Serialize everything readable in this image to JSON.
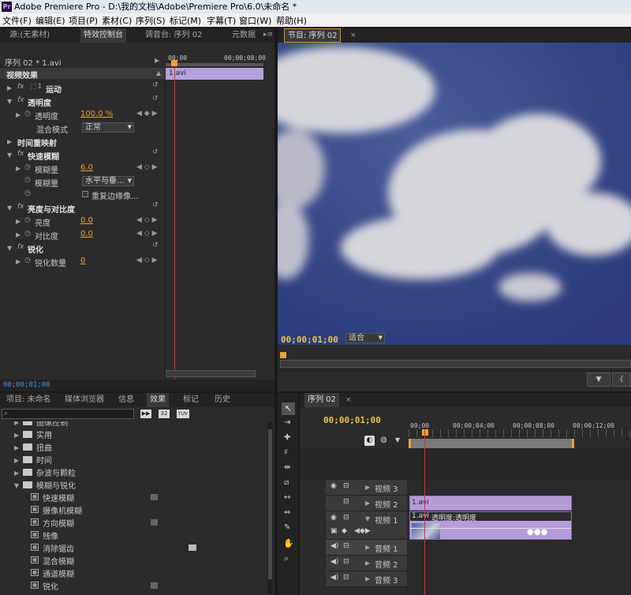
{
  "titlebar": {
    "icon": "Pr",
    "title": "Adobe Premiere Pro - D:\\我的文档\\Adobe\\Premiere Pro\\6.0\\未命名 *"
  },
  "menubar": [
    "文件(F)",
    "编辑(E)",
    "项目(P)",
    "素材(C)",
    "序列(S)",
    "标记(M)",
    "字幕(T)",
    "窗口(W)",
    "帮助(H)"
  ],
  "effect_controls": {
    "tabs": [
      "源:(无素材)",
      "特效控制台",
      "调音台: 序列 02",
      "元数据"
    ],
    "sequence": "序列 02 * 1.avi",
    "ruler_start": "00;00",
    "ruler_end": "00;00;08;00",
    "clip_label": "1.avi",
    "section": "视频效果",
    "motion": "运动",
    "opacity": "透明度",
    "opacity_param": "透明度",
    "opacity_value": "100.0 %",
    "blend_label": "混合模式",
    "blend_value": "正常",
    "time_remap": "时间重映射",
    "fast_blur": "快速模糊",
    "blur_param": "模糊量",
    "blur_value": "6.0",
    "blur_dim_label": "模糊量",
    "blur_dim_value": "水平与垂...",
    "repeat_edge": "重复边缘像...",
    "bc": "亮度与对比度",
    "brightness": "亮度",
    "brightness_value": "0.0",
    "contrast": "对比度",
    "contrast_value": "0.0",
    "sharpen": "锐化",
    "sharpen_amount": "锐化数量",
    "sharpen_value": "0",
    "timecode": "00;00;01;00"
  },
  "program": {
    "tab": "节目: 序列 02",
    "timecode": "00;00;01;00",
    "zoom": "适合"
  },
  "project": {
    "tabs": [
      "项目: 未命名",
      "媒体浏览器",
      "信息",
      "效果",
      "标记",
      "历史"
    ],
    "search_placeholder": "",
    "btn_a": "32",
    "btn_b": "YUV",
    "items": [
      {
        "name": "图像控制",
        "level": 1,
        "type": "folder"
      },
      {
        "name": "实用",
        "level": 1,
        "type": "folder"
      },
      {
        "name": "扭曲",
        "level": 1,
        "type": "folder"
      },
      {
        "name": "时间",
        "level": 1,
        "type": "folder"
      },
      {
        "name": "杂波与颗粒",
        "level": 1,
        "type": "folder"
      },
      {
        "name": "模糊与锐化",
        "level": 1,
        "type": "folder",
        "open": true
      },
      {
        "name": "快速模糊",
        "level": 2,
        "type": "effect"
      },
      {
        "name": "摄像机模糊",
        "level": 2,
        "type": "effect"
      },
      {
        "name": "方向模糊",
        "level": 2,
        "type": "effect"
      },
      {
        "name": "残像",
        "level": 2,
        "type": "effect"
      },
      {
        "name": "消除锯齿",
        "level": 2,
        "type": "effect"
      },
      {
        "name": "混合模糊",
        "level": 2,
        "type": "effect"
      },
      {
        "name": "通道模糊",
        "level": 2,
        "type": "effect"
      },
      {
        "name": "锐化",
        "level": 2,
        "type": "effect"
      }
    ]
  },
  "timeline": {
    "tab": "序列 02",
    "timecode": "00;00;01;00",
    "ruler": [
      "00;00",
      "00;00;04;00",
      "00;00;08;00",
      "00;00;12;00"
    ],
    "tracks": [
      "视频 3",
      "视频 2",
      "视频 1",
      "音频 1",
      "音频 2",
      "音频 3"
    ],
    "clip_v2": "1.avi",
    "clip_v1": "1.avi",
    "clip_v1_fx": "透明度:透明度"
  }
}
